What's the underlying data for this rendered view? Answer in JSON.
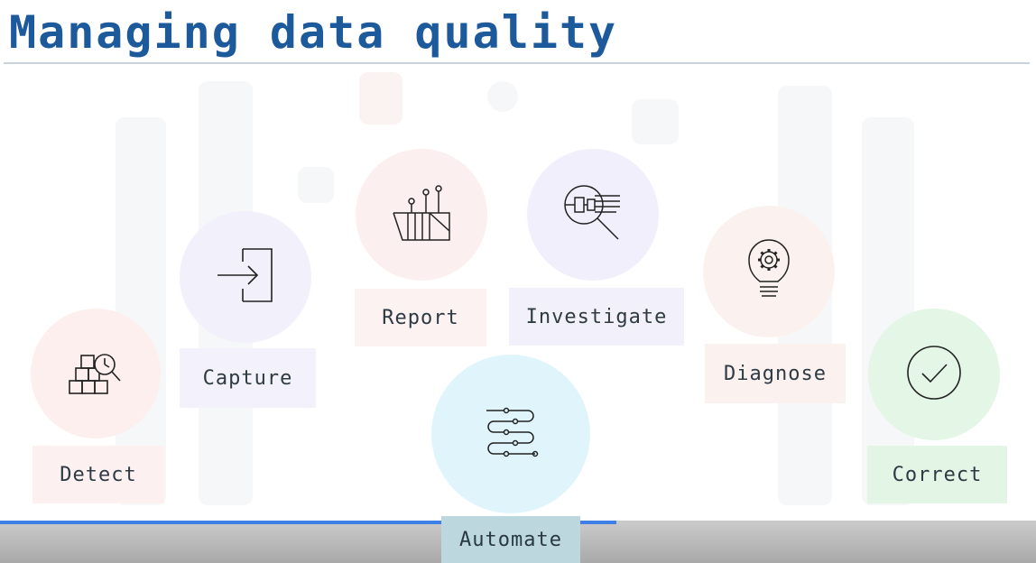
{
  "slide": {
    "title": "Managing data quality"
  },
  "steps": [
    {
      "key": "detect",
      "label": "Detect",
      "icon": "boxes-magnifier-icon",
      "circle_color": "#fcefee",
      "label_bg": "#fcf1f0"
    },
    {
      "key": "capture",
      "label": "Capture",
      "icon": "sign-in-icon",
      "circle_color": "#f2f0fb",
      "label_bg": "#f3f1fb"
    },
    {
      "key": "report",
      "label": "Report",
      "icon": "report-chart-icon",
      "circle_color": "#fbf0ef",
      "label_bg": "#fbf2f1"
    },
    {
      "key": "investigate",
      "label": "Investigate",
      "icon": "circuit-magnifier-icon",
      "circle_color": "#f1effb",
      "label_bg": "#f2f0fb"
    },
    {
      "key": "diagnose",
      "label": "Diagnose",
      "icon": "lightbulb-gear-icon",
      "circle_color": "#fbf1ef",
      "label_bg": "#fbf2f0"
    },
    {
      "key": "correct",
      "label": "Correct",
      "icon": "checkmark-circle-icon",
      "circle_color": "#e4f6e6",
      "label_bg": "#e3f5e5"
    },
    {
      "key": "automate",
      "label": "Automate",
      "icon": "flow-lines-icon",
      "circle_color": "#dff5fb",
      "label_bg": "#d4eff6"
    }
  ],
  "player": {
    "progress": 0.595,
    "progress_color": "#3f7fe6"
  }
}
